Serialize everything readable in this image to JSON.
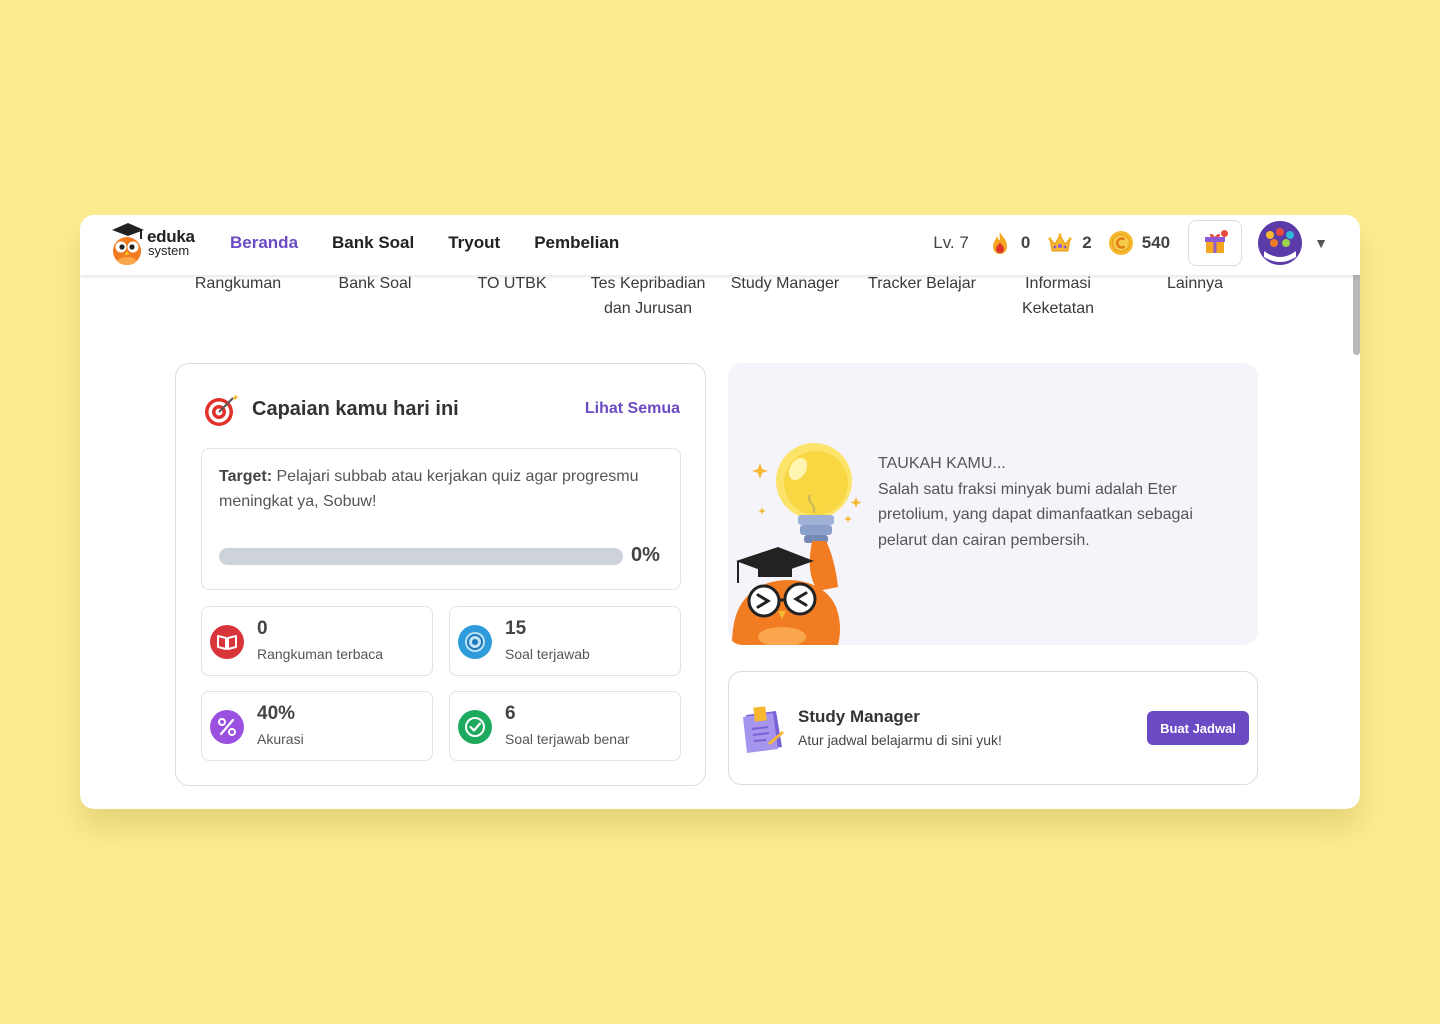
{
  "app": {
    "logo_main": "eduka",
    "logo_sub": "system"
  },
  "nav": {
    "items": [
      {
        "label": "Beranda",
        "active": true
      },
      {
        "label": "Bank Soal",
        "active": false
      },
      {
        "label": "Tryout",
        "active": false
      },
      {
        "label": "Pembelian",
        "active": false
      }
    ]
  },
  "stats": {
    "level": "Lv. 7",
    "streak": "0",
    "crowns": "2",
    "coins": "540"
  },
  "menu": {
    "items": [
      {
        "label": "Rangkuman"
      },
      {
        "label": "Bank Soal"
      },
      {
        "label": "TO UTBK"
      },
      {
        "label": "Tes Kepribadian dan Jurusan"
      },
      {
        "label": "Study Manager"
      },
      {
        "label": "Tracker Belajar"
      },
      {
        "label": "Informasi Keketatan"
      },
      {
        "label": "Lainnya"
      }
    ]
  },
  "achievement": {
    "title": "Capaian kamu hari ini",
    "link": "Lihat Semua",
    "target_label": "Target:",
    "target_text": "Pelajari subbab atau kerjakan quiz agar progresmu meningkat ya, Sobuw!",
    "progress_percent": 0,
    "progress_text": "0%",
    "cards": [
      {
        "value": "0",
        "label": "Rangkuman terbaca",
        "icon": "book-icon",
        "color": "#D8353B"
      },
      {
        "value": "15",
        "label": "Soal terjawab",
        "icon": "target-icon",
        "color": "#2E9CDB"
      },
      {
        "value": "40%",
        "label": "Akurasi",
        "icon": "percent-icon",
        "color": "#9B51E0"
      },
      {
        "value": "6",
        "label": "Soal terjawab benar",
        "icon": "check-icon",
        "color": "#1DAA5E"
      }
    ]
  },
  "fact": {
    "heading": "TAUKAH KAMU...",
    "body": "Salah satu fraksi minyak bumi adalah Eter pretolium, yang dapat dimanfaatkan sebagai pelarut dan cairan pembersih."
  },
  "study_manager": {
    "title": "Study Manager",
    "subtitle": "Atur jadwal belajarmu di sini yuk!",
    "button": "Buat Jadwal"
  },
  "colors": {
    "accent": "#6A4BC4",
    "background": "#FDEC90"
  }
}
